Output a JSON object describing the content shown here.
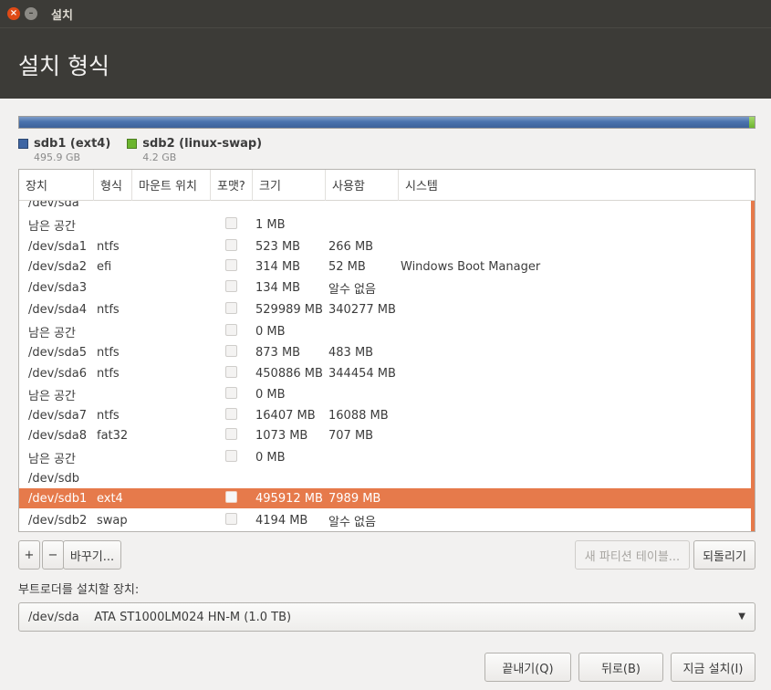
{
  "window": {
    "title": "설치",
    "close_glyph": "×",
    "minimize_glyph": "–"
  },
  "header": {
    "title": "설치 형식"
  },
  "disk_usage": {
    "fill": {
      "sdb1_fraction": 0.992,
      "sdb2_fraction": 0.008
    },
    "colors": {
      "ext4": "#4a6fa5",
      "swap": "#6cb52e"
    }
  },
  "legend": [
    {
      "name": "sdb1 (ext4)",
      "size": "495.9 GB",
      "color": "#3f66a3"
    },
    {
      "name": "sdb2 (linux-swap)",
      "size": "4.2 GB",
      "color": "#6cb52e"
    }
  ],
  "table": {
    "columns": [
      "장치",
      "형식",
      "마운트 위치",
      "포맷?",
      "크기",
      "사용함",
      "시스템"
    ],
    "rows": [
      {
        "device": "/dev/sda",
        "kind": "group"
      },
      {
        "device": "남은 공간",
        "type": "",
        "mount": "",
        "size": "1 MB",
        "used": "",
        "system": ""
      },
      {
        "device": "/dev/sda1",
        "type": "ntfs",
        "mount": "",
        "size": "523 MB",
        "used": "266 MB",
        "system": ""
      },
      {
        "device": "/dev/sda2",
        "type": "efi",
        "mount": "",
        "size": "314 MB",
        "used": "52 MB",
        "system": "Windows Boot Manager"
      },
      {
        "device": "/dev/sda3",
        "type": "",
        "mount": "",
        "size": "134 MB",
        "used": "알수 없음",
        "system": ""
      },
      {
        "device": "/dev/sda4",
        "type": "ntfs",
        "mount": "",
        "size": "529989 MB",
        "used": "340277 MB",
        "system": ""
      },
      {
        "device": "남은 공간",
        "type": "",
        "mount": "",
        "size": "0 MB",
        "used": "",
        "system": ""
      },
      {
        "device": "/dev/sda5",
        "type": "ntfs",
        "mount": "",
        "size": "873 MB",
        "used": "483 MB",
        "system": ""
      },
      {
        "device": "/dev/sda6",
        "type": "ntfs",
        "mount": "",
        "size": "450886 MB",
        "used": "344454 MB",
        "system": ""
      },
      {
        "device": "남은 공간",
        "type": "",
        "mount": "",
        "size": "0 MB",
        "used": "",
        "system": ""
      },
      {
        "device": "/dev/sda7",
        "type": "ntfs",
        "mount": "",
        "size": "16407 MB",
        "used": "16088 MB",
        "system": ""
      },
      {
        "device": "/dev/sda8",
        "type": "fat32",
        "mount": "",
        "size": "1073 MB",
        "used": "707 MB",
        "system": ""
      },
      {
        "device": "남은 공간",
        "type": "",
        "mount": "",
        "size": "0 MB",
        "used": "",
        "system": ""
      },
      {
        "device": "/dev/sdb",
        "kind": "group"
      },
      {
        "device": "/dev/sdb1",
        "type": "ext4",
        "mount": "",
        "size": "495912 MB",
        "used": "7989 MB",
        "system": "",
        "selected": true
      },
      {
        "device": "/dev/sdb2",
        "type": "swap",
        "mount": "",
        "size": "4194 MB",
        "used": "알수 없음",
        "system": ""
      }
    ]
  },
  "toolbar": {
    "add_label": "+",
    "remove_label": "−",
    "change_label": "바꾸기...",
    "new_table_label": "새 파티션 테이블...",
    "revert_label": "되돌리기"
  },
  "bootloader": {
    "label": "부트로더를 설치할 장치:",
    "selected": "/dev/sda    ATA ST1000LM024 HN-M (1.0 TB)",
    "arrow": "▼"
  },
  "buttons": {
    "quit": "끝내기(Q)",
    "back": "뒤로(B)",
    "install_now": "지금 설치(I)"
  }
}
